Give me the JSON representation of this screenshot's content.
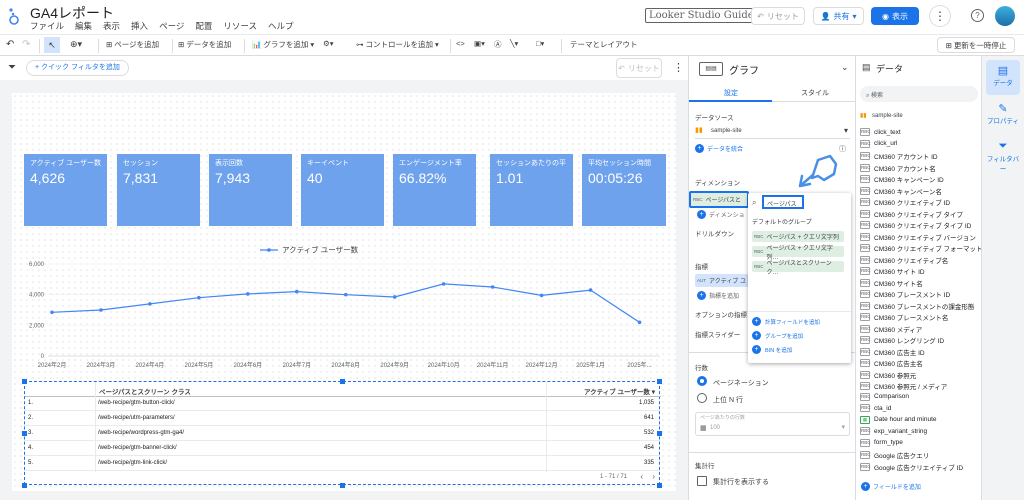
{
  "app": {
    "title": "GA4レポート",
    "menu": [
      "ファイル",
      "編集",
      "表示",
      "挿入",
      "ページ",
      "配置",
      "リソース",
      "ヘルプ"
    ],
    "brand": "Looker Studio Guide",
    "reset": "リセット",
    "share": "共有",
    "view": "表示"
  },
  "toolbar": {
    "add_page": "ページを追加",
    "add_data": "データを追加",
    "add_chart": "グラフを追加",
    "add_control": "コントロールを追加",
    "theme": "テーマとレイアウト",
    "pause": "更新を一時停止"
  },
  "filterbar": {
    "quick_filter": "+ クイック フィルタを追加",
    "reset": "リセット"
  },
  "kpis": [
    {
      "label": "アクティブ ユーザー数",
      "value": "4,626"
    },
    {
      "label": "セッション",
      "value": "7,831"
    },
    {
      "label": "表示回数",
      "value": "7,943"
    },
    {
      "label": "キーイベント",
      "value": "40"
    },
    {
      "label": "エンゲージメント率",
      "value": "66.82%"
    },
    {
      "label": "セッションあたりの平",
      "value": "1.01"
    },
    {
      "label": "平均セッション時間",
      "value": "00:05:26"
    }
  ],
  "chart_data": {
    "type": "line",
    "legend": "アクティブ ユーザー数",
    "categories": [
      "2024年2月",
      "2024年3月",
      "2024年4月",
      "2024年5月",
      "2024年6月",
      "2024年7月",
      "2024年8月",
      "2024年9月",
      "2024年10月",
      "2024年11月",
      "2024年12月",
      "2025年1月",
      "2025年..."
    ],
    "values": [
      2850,
      3000,
      3400,
      3800,
      4050,
      4200,
      4000,
      3850,
      4700,
      4500,
      3950,
      4300,
      2200
    ],
    "yticks": [
      "6,000",
      "4,000",
      "2,000",
      "0"
    ],
    "ylim": [
      0,
      6000
    ],
    "color": "#4285f4"
  },
  "table": {
    "headers": [
      "ページパスとスクリーン クラス",
      "アクティブ ユーザー数 ▾"
    ],
    "rows": [
      {
        "n": "1.",
        "path": "/web-recipe/gtm-button-click/",
        "users": "1,035"
      },
      {
        "n": "2.",
        "path": "/web-recipe/utm-parameters/",
        "users": "641"
      },
      {
        "n": "3.",
        "path": "/web-recipe/wordpress-gtm-ga4/",
        "users": "532"
      },
      {
        "n": "4.",
        "path": "/web-recipe/gtm-banner-click/",
        "users": "454"
      },
      {
        "n": "5.",
        "path": "/web-recipe/gtm-link-click/",
        "users": "335"
      }
    ],
    "pagination": "1 - 71 / 71"
  },
  "props": {
    "title": "グラフ",
    "tab_setup": "設定",
    "tab_style": "スタイル",
    "datasource_label": "データソース",
    "datasource": "sample-site",
    "blend": "データを統合",
    "dimension_label": "ディメンション",
    "dimension": "ページパスと",
    "dimension_add": "ディメンショ",
    "drilldown": "ドリルダウン",
    "metric_label": "指標",
    "metric": "アクティブ ユ",
    "metric_add": "指標を追加",
    "optional_metrics": "オプションの指標",
    "metric_slider": "指標スライダー",
    "rows_label": "行数",
    "pagination": "ページネーション",
    "top_n": "上位 N 行",
    "per_page_label": "ページあたりの行数",
    "per_page": "100",
    "summary_label": "集計行",
    "summary": "集計行を表示する"
  },
  "dropdown": {
    "search": "ページパス",
    "group": "デフォルトのグループ",
    "items": [
      "ページパス + クエリ文字列",
      "ページパス + クエリ文字列…",
      "ページパスとスクリーン ク…"
    ],
    "actions": [
      "計算フィールドを追加",
      "グループを追加",
      "BIN を追加"
    ]
  },
  "data_panel": {
    "title": "データ",
    "search": "検索",
    "source": "sample-site",
    "fields": [
      "click_text",
      "click_url",
      "CM360 アカウント ID",
      "CM360 アカウント名",
      "CM360 キャンペーン ID",
      "CM360 キャンペーン名",
      "CM360 クリエイティブ ID",
      "CM360 クリエイティブ タイプ",
      "CM360 クリエイティブ タイプ ID",
      "CM360 クリエイティブ バージョン",
      "CM360 クリエイティブ フォーマット",
      "CM360 クリエイティブ名",
      "CM360 サイト ID",
      "CM360 サイト名",
      "CM360 プレースメント ID",
      "CM360 プレースメントの課金形態",
      "CM360 プレースメント名",
      "CM360 メディア",
      "CM360 レングリング ID",
      "CM360 広告主 ID",
      "CM360 広告主名",
      "CM360 参照元",
      "CM360 参照元 / メディア",
      "Comparison",
      "cta_id",
      "Date hour and minute",
      "exp_variant_string",
      "form_type",
      "Google 広告クエリ",
      "Google 広告クリエイティブ ID"
    ],
    "add_field": "フィールドを追加"
  },
  "right_tabs": [
    "データ",
    "プロパティ",
    "フィルタバー"
  ]
}
